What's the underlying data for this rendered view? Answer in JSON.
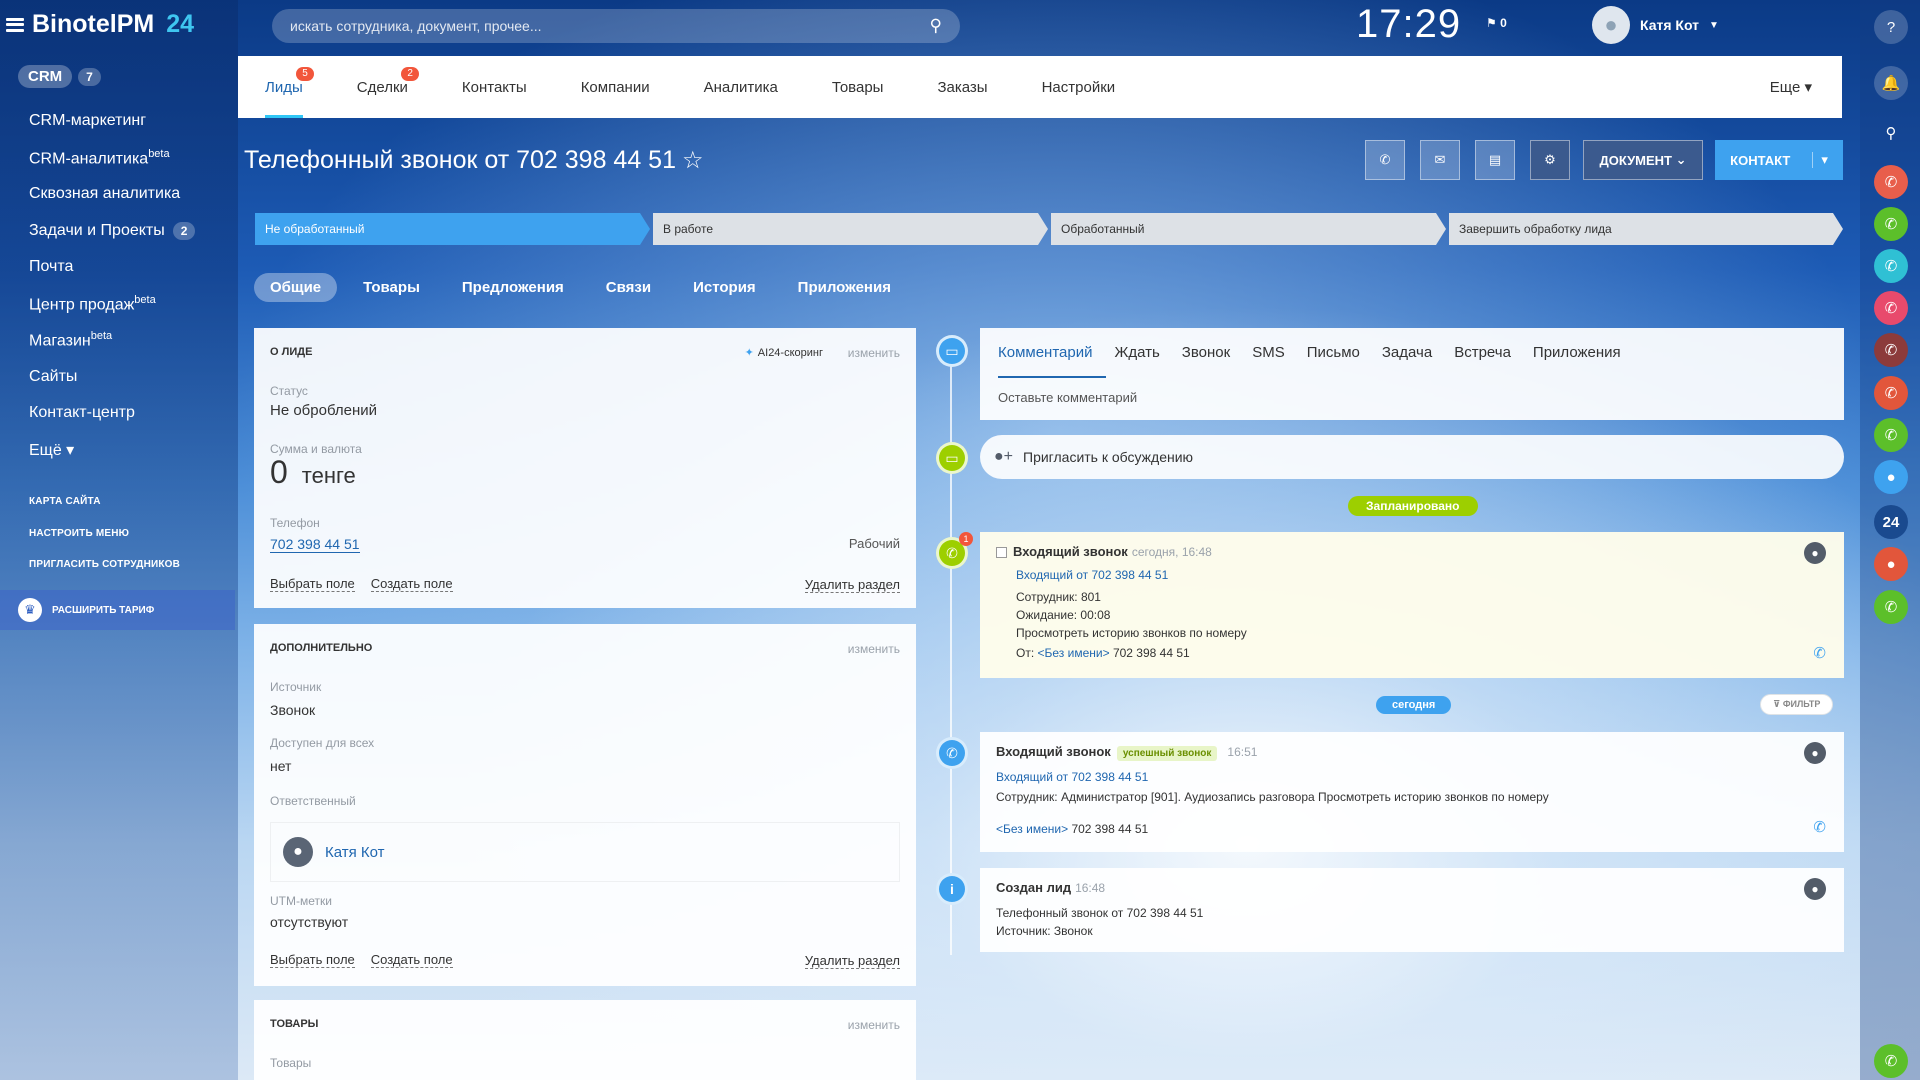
{
  "app": {
    "name": "BinotelPM",
    "name_num": "24"
  },
  "header": {
    "search_placeholder": "искать сотрудника, документ, прочее...",
    "clock": "17:29",
    "flag_count": "0",
    "user_name": "Катя Кот"
  },
  "sidebar": {
    "crm_label": "CRM",
    "crm_count": "7",
    "items": [
      {
        "label": "CRM-маркетинг"
      },
      {
        "label": "CRM-аналитика",
        "sup": "beta"
      },
      {
        "label": "Сквозная аналитика"
      },
      {
        "label": "Задачи и Проекты",
        "count": "2"
      },
      {
        "label": "Почта"
      },
      {
        "label": "Центр продаж",
        "sup": "beta"
      },
      {
        "label": "Магазин",
        "sup": "beta"
      },
      {
        "label": "Сайты"
      },
      {
        "label": "Контакт-центр"
      },
      {
        "label": "Ещё ▾"
      }
    ],
    "small_links": [
      "Карта сайта",
      "Настроить меню",
      "Пригласить сотрудников"
    ],
    "upgrade_label": "Расширить тариф"
  },
  "tabs": [
    {
      "label": "Лиды",
      "badge": "5"
    },
    {
      "label": "Сделки",
      "badge": "2"
    },
    {
      "label": "Контакты"
    },
    {
      "label": "Компании"
    },
    {
      "label": "Аналитика"
    },
    {
      "label": "Товары"
    },
    {
      "label": "Заказы"
    },
    {
      "label": "Настройки"
    }
  ],
  "tabs_more": "Еще ▾",
  "page_title": "Телефонный звонок от 702 398 44 51",
  "toolbar": {
    "document_label": "ДОКУМЕНТ",
    "contact_label": "КОНТАКТ"
  },
  "stages": [
    "Не обработанный",
    "В работе",
    "Обработанный",
    "Завершить обработку лида"
  ],
  "subtabs": [
    "Общие",
    "Товары",
    "Предложения",
    "Связи",
    "История",
    "Приложения"
  ],
  "about": {
    "title": "О лиде",
    "ai_score": "AI24-скоринг",
    "edit": "изменить",
    "status_label": "Статус",
    "status_value": "Не оброблений",
    "amount_label": "Сумма и валюта",
    "amount_value": "0",
    "amount_currency": "тенге",
    "phone_label": "Телефон",
    "phone_value": "702 398 44 51",
    "phone_type": "Рабочий",
    "select_field": "Выбрать поле",
    "create_field": "Создать поле",
    "delete_section": "Удалить раздел"
  },
  "extra": {
    "title": "Дополнительно",
    "edit": "изменить",
    "source_label": "Источник",
    "source_value": "Звонок",
    "available_label": "Доступен для всех",
    "available_value": "нет",
    "responsible_label": "Ответственный",
    "responsible_value": "Катя Кот",
    "utm_label": "UTM-метки",
    "utm_value": "отсутствуют",
    "select_field": "Выбрать поле",
    "create_field": "Создать поле",
    "delete_section": "Удалить раздел"
  },
  "products": {
    "title": "Товары",
    "edit": "изменить",
    "label": "Товары"
  },
  "comment_tabs": [
    "Комментарий",
    "Ждать",
    "Звонок",
    "SMS",
    "Письмо",
    "Задача",
    "Встреча",
    "Приложения"
  ],
  "comment_placeholder": "Оставьте комментарий",
  "invite_label": "Пригласить к обсуждению",
  "planned_label": "Запланировано",
  "today_label": "сегодня",
  "filter_label": "Фильтр",
  "planned_call": {
    "badge": "1",
    "title": "Входящий звонок",
    "time": "сегодня, 16:48",
    "from_link": "Входящий от 702 398 44 51",
    "employees": "Сотрудник: 801",
    "waiting": "Ожидание: 00:08",
    "history": "Просмотреть историю звонков по номеру",
    "from_prefix": "От:",
    "from_name": "<Без имени>",
    "from_number": "702 398 44 51"
  },
  "done_call": {
    "title": "Входящий звонок",
    "status": "успешный звонок",
    "time": "16:51",
    "from_link": "Входящий от 702 398 44 51",
    "details": "Сотрудник: Администратор [901]. Аудиозапись разговора Просмотреть историю звонков по номеру",
    "from_name": "<Без имени>",
    "from_number": "702 398 44 51"
  },
  "created": {
    "title": "Создан лид",
    "time": "16:48",
    "line1": "Телефонный звонок от 702 398 44 51",
    "line2": "Источник: Звонок"
  }
}
